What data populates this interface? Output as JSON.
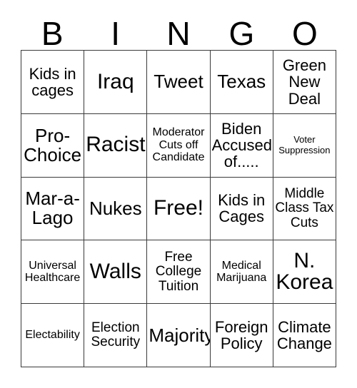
{
  "card": {
    "header_letters": [
      "B",
      "I",
      "N",
      "G",
      "O"
    ],
    "columns": 5,
    "rows": 5,
    "colors": {
      "background": "#ffffff",
      "cell_background": "#ffffff",
      "border": "#3a3a3a",
      "text": "#000000"
    },
    "cells": [
      {
        "text": "Kids in cages",
        "size": "lg",
        "free": false
      },
      {
        "text": "Iraq",
        "size": "xxl",
        "free": false
      },
      {
        "text": "Tweet",
        "size": "xl",
        "free": false
      },
      {
        "text": "Texas",
        "size": "xl",
        "free": false
      },
      {
        "text": "Green New Deal",
        "size": "lg",
        "free": false
      },
      {
        "text": "Pro-Choice",
        "size": "xl",
        "free": false
      },
      {
        "text": "Racist",
        "size": "xxl",
        "free": false
      },
      {
        "text": "Moderator Cuts off Candidate",
        "size": "sm",
        "free": false
      },
      {
        "text": "Biden Accused of.....",
        "size": "lg",
        "free": false
      },
      {
        "text": "Voter Suppression",
        "size": "xs",
        "free": false
      },
      {
        "text": "Mar-a-Lago",
        "size": "xl",
        "free": false
      },
      {
        "text": "Nukes",
        "size": "xl",
        "free": false
      },
      {
        "text": "Free!",
        "size": "xxl",
        "free": true
      },
      {
        "text": "Kids in Cages",
        "size": "lg",
        "free": false
      },
      {
        "text": "Middle Class Tax Cuts",
        "size": "md",
        "free": false
      },
      {
        "text": "Universal Healthcare",
        "size": "sm",
        "free": false
      },
      {
        "text": "Walls",
        "size": "xxl",
        "free": false
      },
      {
        "text": "Free College Tuition",
        "size": "md",
        "free": false
      },
      {
        "text": "Medical Marijuana",
        "size": "sm",
        "free": false
      },
      {
        "text": "N. Korea",
        "size": "xxl",
        "free": false
      },
      {
        "text": "Electability",
        "size": "sm",
        "free": false
      },
      {
        "text": "Election Security",
        "size": "md",
        "free": false
      },
      {
        "text": "Majority",
        "size": "xl",
        "free": false
      },
      {
        "text": "Foreign Policy",
        "size": "lg",
        "free": false
      },
      {
        "text": "Climate Change",
        "size": "lg",
        "free": false
      }
    ]
  }
}
